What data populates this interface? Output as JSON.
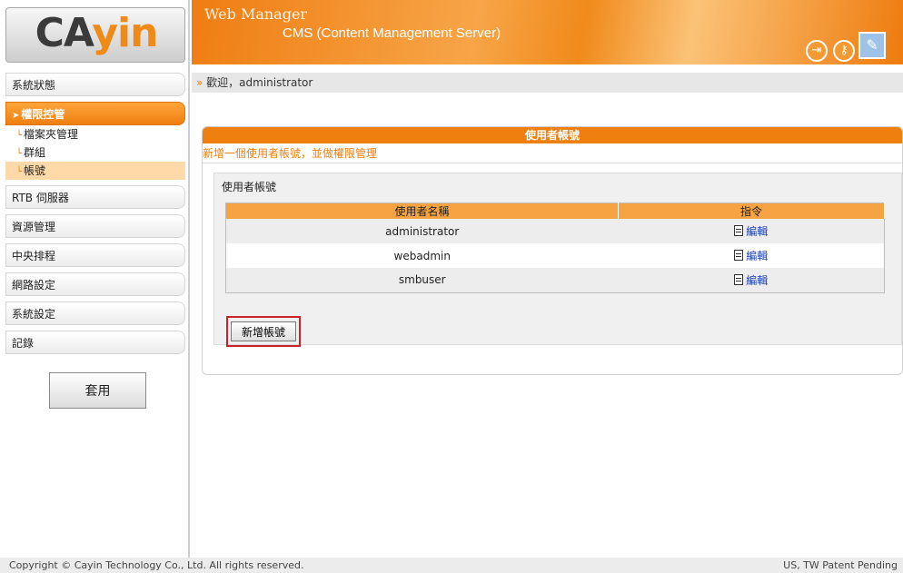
{
  "logo": {
    "prefix": "CA",
    "suffix": "yin"
  },
  "header": {
    "title_line1": "Web Manager",
    "title_line2": "CMS (Content Management Server)",
    "icons": [
      "exit-icon",
      "key-icon",
      "manager-icon"
    ]
  },
  "welcome": {
    "mark": "»",
    "text": "歡迎，administrator"
  },
  "sidebar": {
    "items": [
      {
        "label": "系統狀態"
      },
      {
        "label": "權限控管",
        "active": true
      },
      {
        "label": "RTB 伺服器"
      },
      {
        "label": "資源管理"
      },
      {
        "label": "中央排程"
      },
      {
        "label": "網路設定"
      },
      {
        "label": "系統設定"
      },
      {
        "label": "記錄"
      }
    ],
    "subitems": [
      {
        "label": "檔案夾管理"
      },
      {
        "label": "群組"
      },
      {
        "label": "帳號",
        "active": true
      }
    ],
    "apply_label": "套用"
  },
  "panel": {
    "title": "使用者帳號",
    "subtitle": "新增一個使用者帳號，並做權限管理",
    "box_label": "使用者帳號",
    "columns": [
      "使用者名稱",
      "指令"
    ],
    "rows": [
      {
        "name": "administrator",
        "command": "編輯"
      },
      {
        "name": "webadmin",
        "command": "編輯"
      },
      {
        "name": "smbuser",
        "command": "編輯"
      }
    ],
    "add_button": "新增帳號"
  },
  "footer": {
    "copyright": "Copyright © Cayin Technology Co., Ltd. All rights reserved.",
    "patent": "US, TW Patent Pending"
  },
  "colors": {
    "accent": "#ef7f0f",
    "link": "#1a3fb0",
    "highlight": "#c8232b"
  }
}
